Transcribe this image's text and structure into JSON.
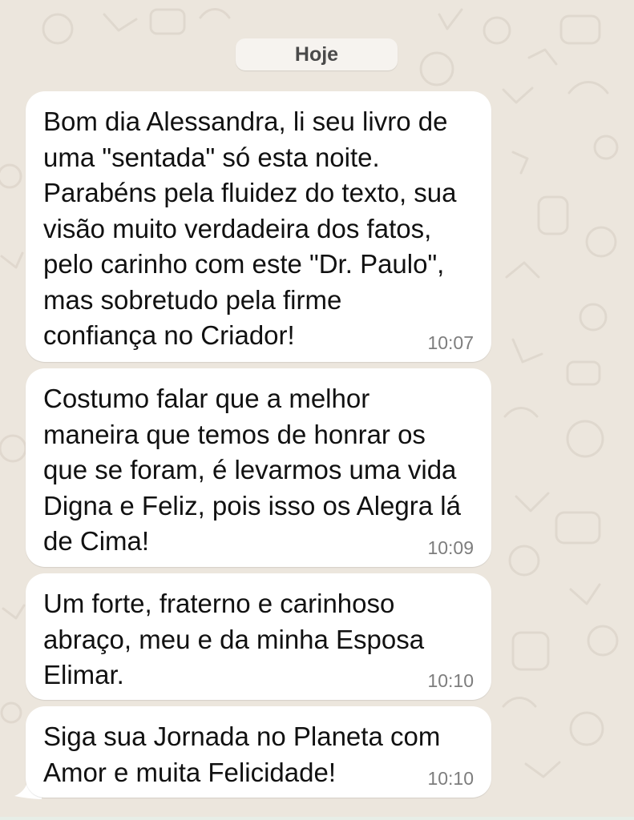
{
  "chat": {
    "date_label": "Hoje",
    "messages": [
      {
        "lines": [
          "Bom dia Alessandra, li seu livro de",
          "uma \"sentada\" só esta noite.",
          "Parabéns pela fluidez do texto, sua",
          "visão muito verdadeira dos fatos,",
          "pelo carinho com este \"Dr. Paulo\",",
          "mas sobretudo pela firme",
          "confiança no Criador!"
        ],
        "time": "10:07"
      },
      {
        "lines": [
          "Costumo falar que a melhor",
          "maneira que temos de honrar os",
          "que se foram, é levarmos uma vida",
          "Digna e Feliz, pois isso os Alegra lá",
          "de Cima!"
        ],
        "time": "10:09"
      },
      {
        "lines": [
          "Um forte, fraterno e carinhoso",
          "abraço,  meu e da minha Esposa",
          "Elimar."
        ],
        "time": "10:10"
      },
      {
        "lines": [
          "Siga sua Jornada no Planeta com",
          "Amor e muita Felicidade!"
        ],
        "time": "10:10"
      }
    ]
  },
  "colors": {
    "background": "#ece6dd",
    "bubble": "#ffffff",
    "date_chip": "#f6f3ef",
    "message_text": "#111111",
    "timestamp": "#7d7d7d"
  },
  "icons": [
    "chat-wallpaper-doodle-pattern"
  ]
}
